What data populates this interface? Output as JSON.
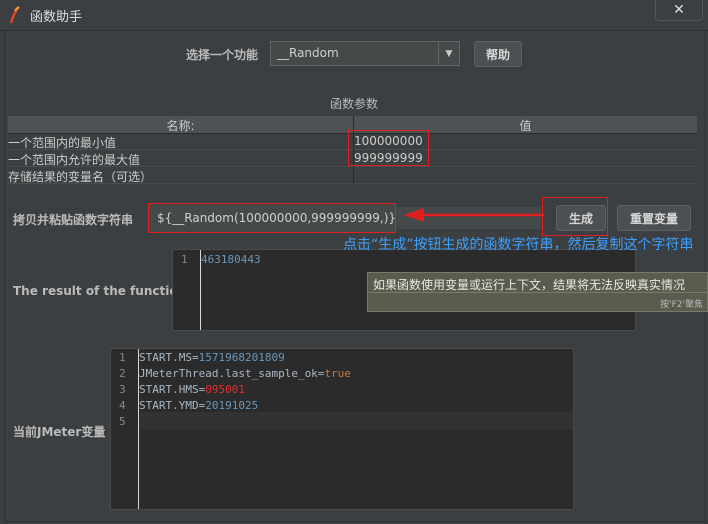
{
  "window": {
    "title": "函数助手",
    "close_glyph": "✕"
  },
  "function_select": {
    "label": "选择一个功能",
    "selected": "__Random",
    "help_button": "帮助"
  },
  "params": {
    "section_title": "函数参数",
    "headers": {
      "name": "名称:",
      "value": "值"
    },
    "rows": [
      {
        "name": "一个范围内的最小值",
        "value": "100000000"
      },
      {
        "name": "一个范围内允许的最大值",
        "value": "999999999"
      },
      {
        "name": "存储结果的变量名（可选）",
        "value": ""
      }
    ]
  },
  "function_string": {
    "label": "拷贝并粘贴函数字符串",
    "value": "${__Random(100000000,999999999,)}",
    "generate_button": "生成",
    "reset_button": "重置变量"
  },
  "annotation": {
    "text": "点击“生成”按钮生成的函数字符串，然后复制这个字符串",
    "color": "#3aa0ff"
  },
  "result": {
    "label": "The result of the function is",
    "lines": [
      {
        "no": "1",
        "text": "463180443"
      }
    ]
  },
  "tooltip": {
    "text": "如果函数使用变量或运行上下文，结果将无法反映真实情况",
    "hint": "按'F2'聚焦"
  },
  "jmeter_vars": {
    "label": "当前JMeter变量",
    "lines": [
      {
        "no": "1",
        "key": "START.MS=",
        "value": "1571968201809"
      },
      {
        "no": "2",
        "key": "JMeterThread.last_sample_ok=",
        "value": "true"
      },
      {
        "no": "3",
        "key": "START.HMS=",
        "value": "095001"
      },
      {
        "no": "4",
        "key": "START.YMD=",
        "value": "20191025"
      },
      {
        "no": "5",
        "key": "",
        "value": ""
      }
    ]
  },
  "colors": {
    "highlight_red": "#e02020",
    "annotation_blue": "#3aa0ff",
    "background": "#3c3f41"
  }
}
